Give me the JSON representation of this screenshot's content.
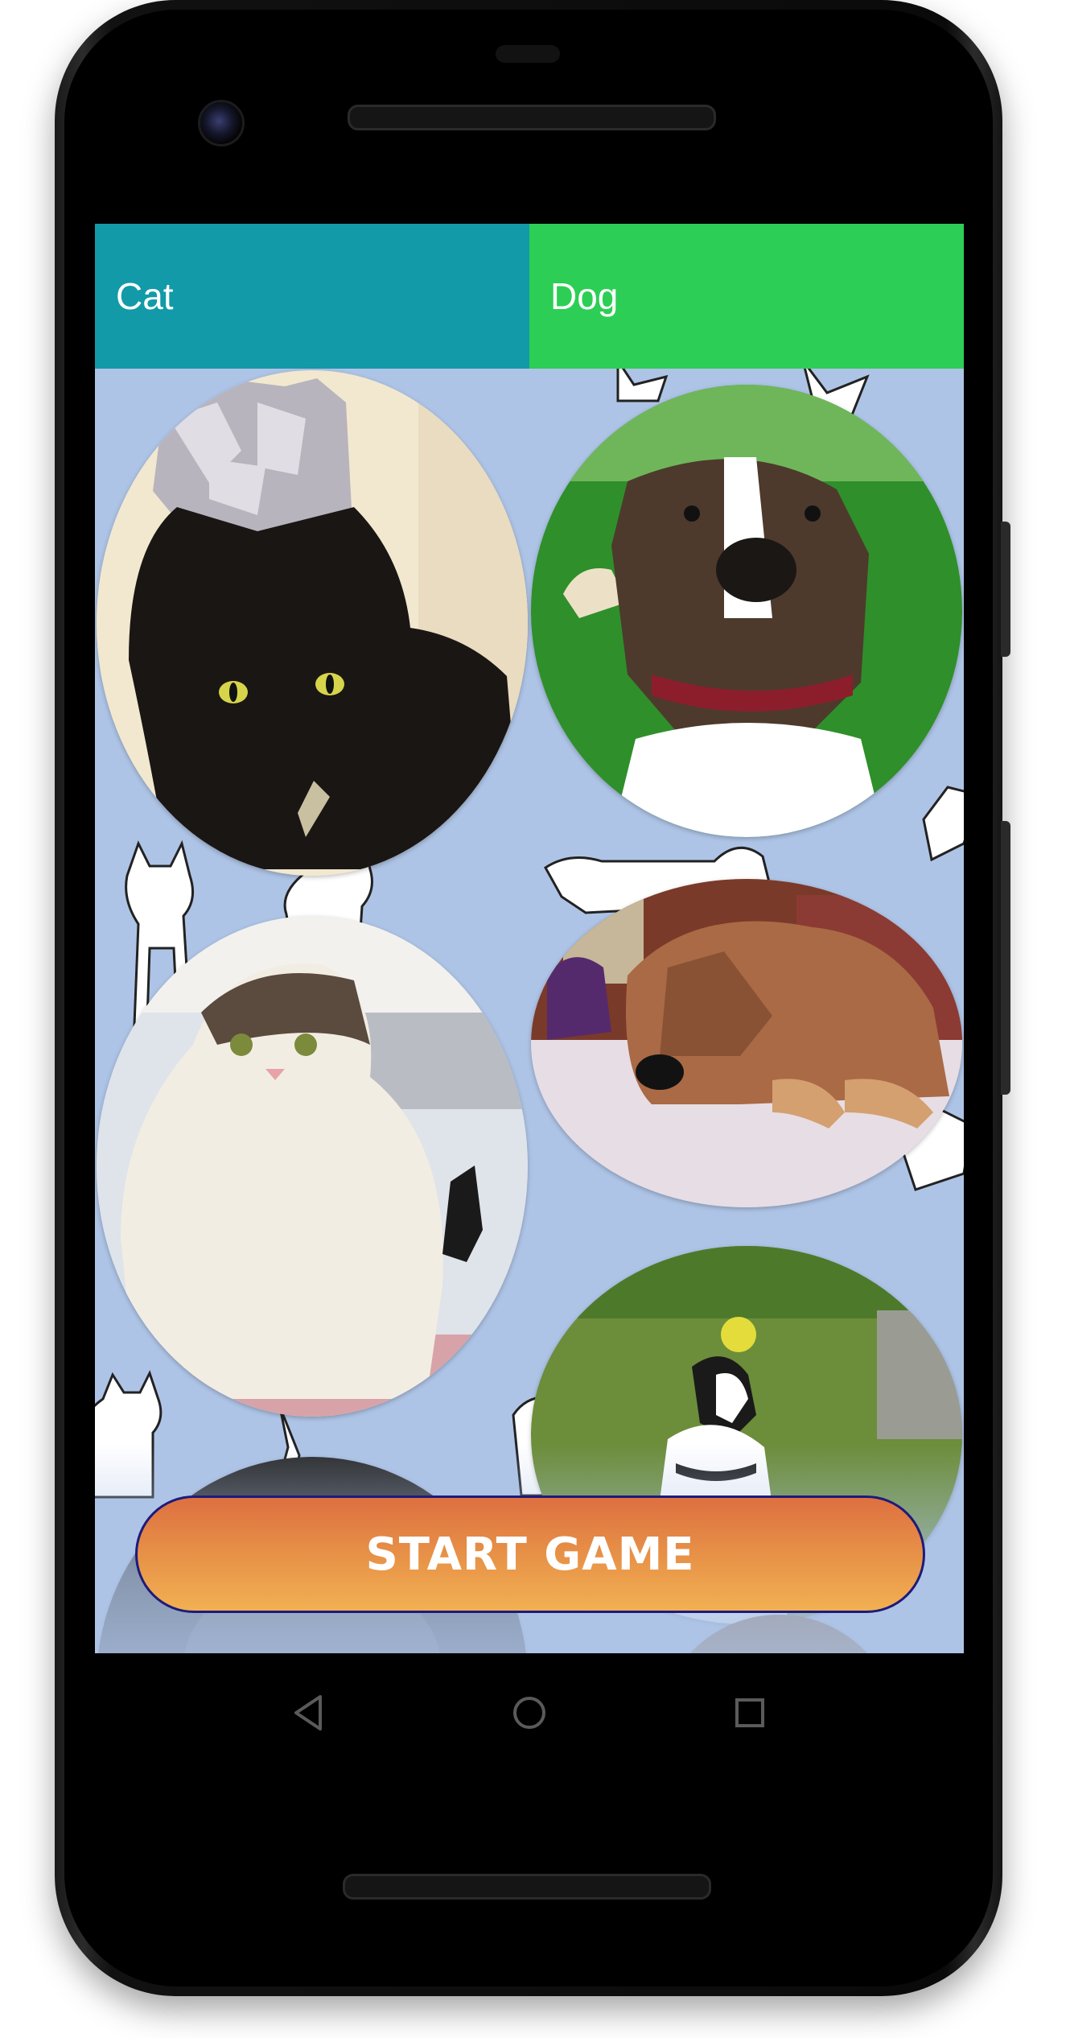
{
  "tabs": [
    {
      "label": "Cat",
      "color": "#129aa8"
    },
    {
      "label": "Dog",
      "color": "#2dce55"
    }
  ],
  "pets": [
    {
      "name": "cat-foil-hat-photo",
      "kind": "cat"
    },
    {
      "name": "dog-brindle-pitbull-photo",
      "kind": "dog"
    },
    {
      "name": "cat-chubby-white-photo",
      "kind": "cat"
    },
    {
      "name": "dog-lying-boxer-photo",
      "kind": "dog"
    },
    {
      "name": "dog-jumping-ball-photo",
      "kind": "dog"
    },
    {
      "name": "cat-partial-photo",
      "kind": "cat"
    },
    {
      "name": "dog-partial-photo",
      "kind": "dog"
    }
  ],
  "start_button": {
    "label": "START GAME"
  },
  "navigation": {
    "back": "back-icon",
    "home": "home-icon",
    "recents": "recents-icon"
  },
  "colors": {
    "background": "#aec4e6",
    "button_top": "#dd7040",
    "button_bottom": "#f2b052",
    "button_border": "#1d1a7c"
  }
}
